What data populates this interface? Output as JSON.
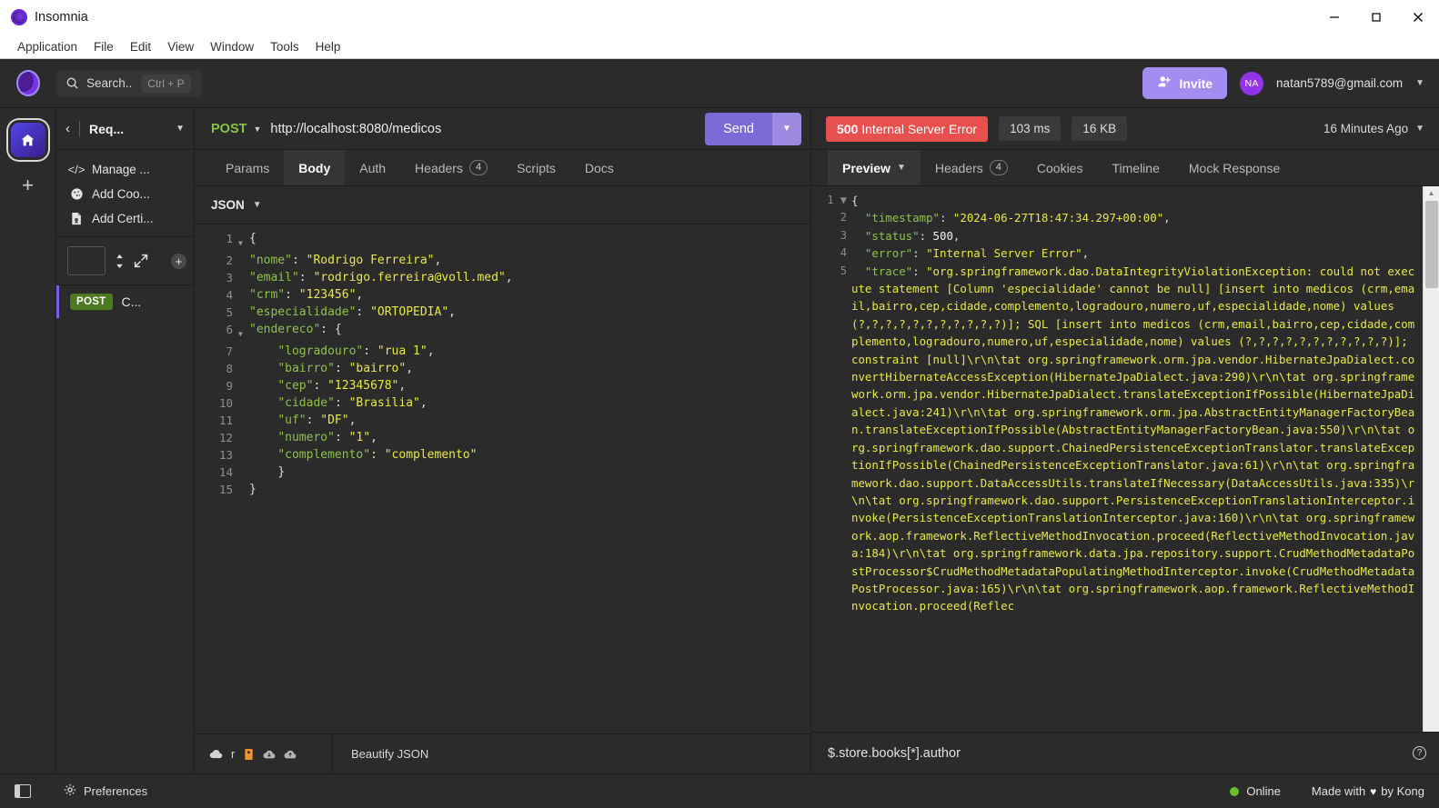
{
  "window": {
    "app_name": "Insomnia",
    "minimize": "minimize-icon",
    "maximize": "maximize-icon",
    "close": "close-icon"
  },
  "menu": [
    "Application",
    "File",
    "Edit",
    "View",
    "Window",
    "Tools",
    "Help"
  ],
  "header": {
    "search_placeholder": "Search..",
    "search_shortcut": "Ctrl + P",
    "invite_label": "Invite",
    "avatar_initials": "NA",
    "email": "natan5789@gmail.com"
  },
  "sidebar": {
    "title": "Req...",
    "actions": [
      {
        "label": "Manage ...",
        "icon": "code-icon"
      },
      {
        "label": "Add Coo...",
        "icon": "cookie-icon"
      },
      {
        "label": "Add Certi...",
        "icon": "certificate-icon"
      }
    ],
    "filter_value": "",
    "request": {
      "method": "POST",
      "name": "C..."
    }
  },
  "request": {
    "method": "POST",
    "url": "http://localhost:8080/medicos",
    "send_label": "Send",
    "tabs": [
      {
        "label": "Params",
        "count": null,
        "active": false
      },
      {
        "label": "Body",
        "count": null,
        "active": true
      },
      {
        "label": "Auth",
        "count": null,
        "active": false
      },
      {
        "label": "Headers",
        "count": "4",
        "active": false
      },
      {
        "label": "Scripts",
        "count": null,
        "active": false
      },
      {
        "label": "Docs",
        "count": null,
        "active": false
      }
    ],
    "body_type": "JSON",
    "body_lines": [
      {
        "n": "1",
        "fold": true,
        "indent": 0,
        "parts": [
          {
            "t": "{",
            "c": "p"
          }
        ]
      },
      {
        "n": "2",
        "fold": false,
        "indent": 0,
        "parts": [
          {
            "t": "\"nome\"",
            "c": "k"
          },
          {
            "t": ": ",
            "c": "p"
          },
          {
            "t": "\"Rodrigo Ferreira\"",
            "c": "s"
          },
          {
            "t": ",",
            "c": "p"
          }
        ]
      },
      {
        "n": "3",
        "fold": false,
        "indent": 0,
        "parts": [
          {
            "t": "\"email\"",
            "c": "k"
          },
          {
            "t": ": ",
            "c": "p"
          },
          {
            "t": "\"rodrigo.ferreira@voll.med\"",
            "c": "s"
          },
          {
            "t": ",",
            "c": "p"
          }
        ]
      },
      {
        "n": "4",
        "fold": false,
        "indent": 0,
        "parts": [
          {
            "t": "\"crm\"",
            "c": "k"
          },
          {
            "t": ": ",
            "c": "p"
          },
          {
            "t": "\"123456\"",
            "c": "s"
          },
          {
            "t": ",",
            "c": "p"
          }
        ]
      },
      {
        "n": "5",
        "fold": false,
        "indent": 0,
        "parts": [
          {
            "t": "\"especialidade\"",
            "c": "k"
          },
          {
            "t": ": ",
            "c": "p"
          },
          {
            "t": "\"ORTOPEDIA\"",
            "c": "s"
          },
          {
            "t": ",",
            "c": "p"
          }
        ]
      },
      {
        "n": "6",
        "fold": true,
        "indent": 0,
        "parts": [
          {
            "t": "\"endereco\"",
            "c": "k"
          },
          {
            "t": ": {",
            "c": "p"
          }
        ]
      },
      {
        "n": "7",
        "fold": false,
        "indent": 1,
        "parts": [
          {
            "t": "\"logradouro\"",
            "c": "k"
          },
          {
            "t": ": ",
            "c": "p"
          },
          {
            "t": "\"rua 1\"",
            "c": "s"
          },
          {
            "t": ",",
            "c": "p"
          }
        ]
      },
      {
        "n": "8",
        "fold": false,
        "indent": 1,
        "parts": [
          {
            "t": "\"bairro\"",
            "c": "k"
          },
          {
            "t": ": ",
            "c": "p"
          },
          {
            "t": "\"bairro\"",
            "c": "s"
          },
          {
            "t": ",",
            "c": "p"
          }
        ]
      },
      {
        "n": "9",
        "fold": false,
        "indent": 1,
        "parts": [
          {
            "t": "\"cep\"",
            "c": "k"
          },
          {
            "t": ": ",
            "c": "p"
          },
          {
            "t": "\"12345678\"",
            "c": "s"
          },
          {
            "t": ",",
            "c": "p"
          }
        ]
      },
      {
        "n": "10",
        "fold": false,
        "indent": 1,
        "parts": [
          {
            "t": "\"cidade\"",
            "c": "k"
          },
          {
            "t": ": ",
            "c": "p"
          },
          {
            "t": "\"Brasilia\"",
            "c": "s"
          },
          {
            "t": ",",
            "c": "p"
          }
        ]
      },
      {
        "n": "11",
        "fold": false,
        "indent": 1,
        "parts": [
          {
            "t": "\"uf\"",
            "c": "k"
          },
          {
            "t": ": ",
            "c": "p"
          },
          {
            "t": "\"DF\"",
            "c": "s"
          },
          {
            "t": ",",
            "c": "p"
          }
        ]
      },
      {
        "n": "12",
        "fold": false,
        "indent": 1,
        "parts": [
          {
            "t": "\"numero\"",
            "c": "k"
          },
          {
            "t": ": ",
            "c": "p"
          },
          {
            "t": "\"1\"",
            "c": "s"
          },
          {
            "t": ",",
            "c": "p"
          }
        ]
      },
      {
        "n": "13",
        "fold": false,
        "indent": 1,
        "parts": [
          {
            "t": "\"complemento\"",
            "c": "k"
          },
          {
            "t": ": ",
            "c": "p"
          },
          {
            "t": "\"complemento\"",
            "c": "s"
          }
        ]
      },
      {
        "n": "14",
        "fold": false,
        "indent": 1,
        "parts": [
          {
            "t": "}",
            "c": "p"
          }
        ]
      },
      {
        "n": "15",
        "fold": false,
        "indent": 0,
        "parts": [
          {
            "t": "}",
            "c": "p"
          }
        ]
      }
    ],
    "beautify_label": "Beautify JSON",
    "footer_icons": [
      "cloud-icon",
      "cloud-orange-icon",
      "cloud-download-icon",
      "cloud-upload-icon"
    ],
    "footer_text": "r"
  },
  "response": {
    "status_code": "500",
    "status_text": "Internal Server Error",
    "time": "103 ms",
    "size": "16 KB",
    "age": "16 Minutes Ago",
    "tabs": [
      {
        "label": "Preview",
        "count": null,
        "active": true,
        "caret": true
      },
      {
        "label": "Headers",
        "count": "4",
        "active": false,
        "caret": false
      },
      {
        "label": "Cookies",
        "count": null,
        "active": false,
        "caret": false
      },
      {
        "label": "Timeline",
        "count": null,
        "active": false,
        "caret": false
      },
      {
        "label": "Mock Response",
        "count": null,
        "active": false,
        "caret": false
      }
    ],
    "body_lines": [
      {
        "n": "1",
        "fold": true,
        "parts": [
          {
            "t": "{",
            "c": "p"
          }
        ]
      },
      {
        "n": "2",
        "fold": false,
        "parts": [
          {
            "t": "  ",
            "c": "p"
          },
          {
            "t": "\"timestamp\"",
            "c": "k"
          },
          {
            "t": ": ",
            "c": "p"
          },
          {
            "t": "\"2024-06-27T18:47:34.297+00:00\"",
            "c": "s"
          },
          {
            "t": ",",
            "c": "p"
          }
        ]
      },
      {
        "n": "3",
        "fold": false,
        "parts": [
          {
            "t": "  ",
            "c": "p"
          },
          {
            "t": "\"status\"",
            "c": "k"
          },
          {
            "t": ": ",
            "c": "p"
          },
          {
            "t": "500",
            "c": "n"
          },
          {
            "t": ",",
            "c": "p"
          }
        ]
      },
      {
        "n": "4",
        "fold": false,
        "parts": [
          {
            "t": "  ",
            "c": "p"
          },
          {
            "t": "\"error\"",
            "c": "k"
          },
          {
            "t": ": ",
            "c": "p"
          },
          {
            "t": "\"Internal Server Error\"",
            "c": "s"
          },
          {
            "t": ",",
            "c": "p"
          }
        ]
      },
      {
        "n": "5",
        "fold": false,
        "parts": [
          {
            "t": "  ",
            "c": "p"
          },
          {
            "t": "\"trace\"",
            "c": "k"
          },
          {
            "t": ": ",
            "c": "p"
          },
          {
            "t": "\"org.springframework.dao.DataIntegrityViolationException: could not execute statement [Column 'especialidade' cannot be null] [insert into medicos (crm,email,bairro,cep,cidade,complemento,logradouro,numero,uf,especialidade,nome) values (?,?,?,?,?,?,?,?,?,?,?)]; SQL [insert into medicos (crm,email,bairro,cep,cidade,complemento,logradouro,numero,uf,especialidade,nome) values (?,?,?,?,?,?,?,?,?,?,?)]; constraint [null]\\r\\n\\tat org.springframework.orm.jpa.vendor.HibernateJpaDialect.convertHibernateAccessException(HibernateJpaDialect.java:290)\\r\\n\\tat org.springframework.orm.jpa.vendor.HibernateJpaDialect.translateExceptionIfPossible(HibernateJpaDialect.java:241)\\r\\n\\tat org.springframework.orm.jpa.AbstractEntityManagerFactoryBean.translateExceptionIfPossible(AbstractEntityManagerFactoryBean.java:550)\\r\\n\\tat org.springframework.dao.support.ChainedPersistenceExceptionTranslator.translateExceptionIfPossible(ChainedPersistenceExceptionTranslator.java:61)\\r\\n\\tat org.springframework.dao.support.DataAccessUtils.translateIfNecessary(DataAccessUtils.java:335)\\r\\n\\tat org.springframework.dao.support.PersistenceExceptionTranslationInterceptor.invoke(PersistenceExceptionTranslationInterceptor.java:160)\\r\\n\\tat org.springframework.aop.framework.ReflectiveMethodInvocation.proceed(ReflectiveMethodInvocation.java:184)\\r\\n\\tat org.springframework.data.jpa.repository.support.CrudMethodMetadataPostProcessor$CrudMethodMetadataPopulatingMethodInterceptor.invoke(CrudMethodMetadataPostProcessor.java:165)\\r\\n\\tat org.springframework.aop.framework.ReflectiveMethodInvocation.proceed(Reflec",
            "c": "s"
          }
        ]
      }
    ],
    "filter_placeholder": "$.store.books[*].author"
  },
  "statusbar": {
    "preferences_label": "Preferences",
    "online_label": "Online",
    "made_with_prefix": "Made with",
    "made_with_suffix": "by Kong"
  },
  "colors": {
    "accent_purple": "#7e6ad6",
    "error_red": "#e8504d",
    "method_green": "#8bc34a",
    "online_green": "#6abf2a"
  }
}
